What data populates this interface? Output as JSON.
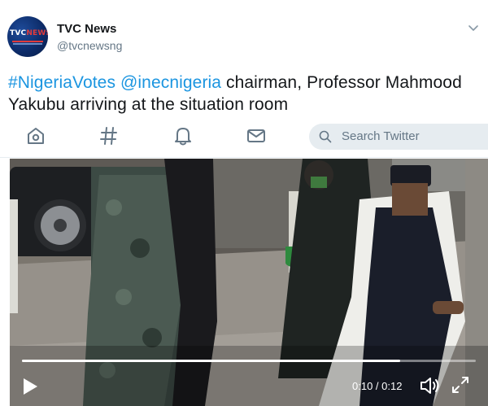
{
  "account": {
    "display_name": "TVC News",
    "handle": "@tvcnewsng",
    "avatar_text_white": "TVC",
    "avatar_text_red": "NEWS"
  },
  "tweet": {
    "hashtag": "#NigeriaVotes",
    "mention": "@inecnigeria",
    "text_rest": " chairman, Professor Mahmood Yakubu arriving at the situation room"
  },
  "nav": {
    "icons": [
      "home-icon",
      "hashtag-icon",
      "bell-icon",
      "envelope-icon"
    ],
    "search_placeholder": "Search Twitter"
  },
  "video": {
    "time_display": "0:10 / 0:12",
    "progress": 0.833
  },
  "colors": {
    "link": "#1b95e0",
    "text": "#14171a",
    "secondary": "#657786"
  }
}
